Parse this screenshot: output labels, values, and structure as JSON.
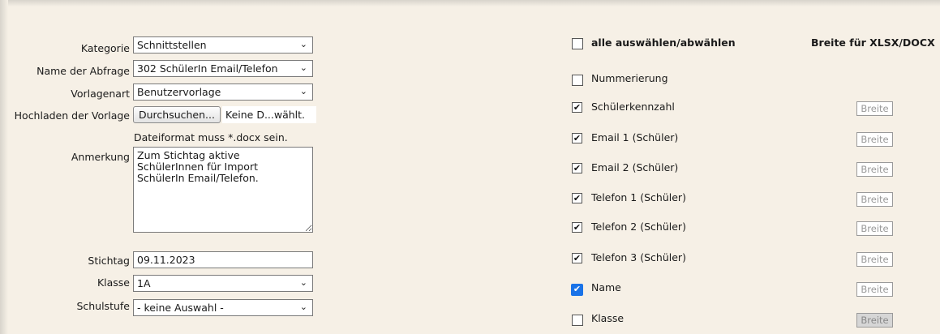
{
  "form": {
    "kategorie": {
      "label": "Kategorie",
      "value": "Schnittstellen"
    },
    "name": {
      "label": "Name der Abfrage",
      "value": "302 SchülerIn Email/Telefon"
    },
    "vorlagenart": {
      "label": "Vorlagenart",
      "value": "Benutzervorlage"
    },
    "upload": {
      "label": "Hochladen der Vorlage",
      "button": "Durchsuchen...",
      "status": "Keine D...wählt."
    },
    "hint": "Dateiformat muss *.docx sein.",
    "anmerkung": {
      "label": "Anmerkung",
      "value": "Zum Stichtag aktive\nSchülerInnen für Import\nSchülerIn Email/Telefon."
    },
    "stichtag": {
      "label": "Stichtag",
      "value": "09.11.2023"
    },
    "klasse": {
      "label": "Klasse",
      "value": "1A"
    },
    "schulstufe": {
      "label": "Schulstufe",
      "value": "- keine Auswahl -"
    }
  },
  "fields": {
    "select_all": "alle auswählen/abwählen",
    "width_header": "Breite für XLSX/DOCX",
    "width_placeholder": "Breite",
    "items": [
      {
        "label": "Nummerierung",
        "checked": false
      },
      {
        "label": "Schülerkennzahl",
        "checked": true
      },
      {
        "label": "Email 1 (Schüler)",
        "checked": true
      },
      {
        "label": "Email 2 (Schüler)",
        "checked": true
      },
      {
        "label": "Telefon 1 (Schüler)",
        "checked": true
      },
      {
        "label": "Telefon 2 (Schüler)",
        "checked": true
      },
      {
        "label": "Telefon 3 (Schüler)",
        "checked": true
      },
      {
        "label": "Name",
        "checked": true
      },
      {
        "label": "Klasse",
        "checked": false
      }
    ]
  },
  "icons": {
    "chevron": "chevron-down-icon",
    "check": "check-icon"
  }
}
